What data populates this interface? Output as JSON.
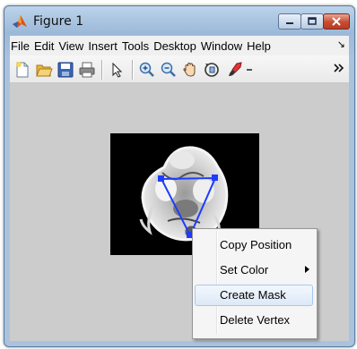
{
  "window": {
    "title": "Figure 1"
  },
  "menubar": {
    "items": [
      "File",
      "Edit",
      "View",
      "Insert",
      "Tools",
      "Desktop",
      "Window",
      "Help"
    ]
  },
  "toolbar": {
    "icons": [
      "new-figure-icon",
      "open-file-icon",
      "save-icon",
      "print-icon",
      "select-arrow-icon",
      "zoom-in-icon",
      "zoom-out-icon",
      "pan-hand-icon",
      "rotate-3d-icon",
      "brush-icon"
    ]
  },
  "context_menu": {
    "items": [
      "Copy Position",
      "Set Color",
      "Create Mask",
      "Delete Vertex"
    ],
    "highlighted": "Create Mask"
  },
  "colors": {
    "polygon": "#1e3cff",
    "title_bar": "#a9c3df",
    "close_button": "#c74b31",
    "figure_background": "#cccccc"
  }
}
